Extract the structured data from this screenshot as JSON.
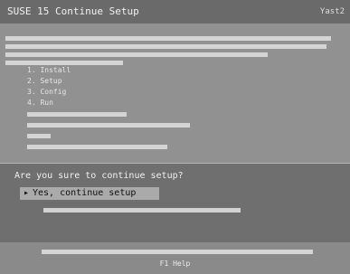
{
  "header": {
    "title": "SUSE 15 Continue Setup",
    "brand": "Yast2"
  },
  "info": {
    "items": [
      {
        "text": "1. Install"
      },
      {
        "text": "2. Setup"
      },
      {
        "text": "3. Config"
      },
      {
        "text": "4. Run"
      },
      {
        "text": ""
      },
      {
        "text": ""
      },
      {
        "text": ""
      },
      {
        "text": ""
      }
    ]
  },
  "prompt": {
    "question": "Are you sure to continue setup?",
    "options": [
      {
        "label": "Yes, continue setup",
        "selected": true
      },
      {
        "label": "",
        "selected": false
      }
    ]
  },
  "footer": {
    "line1": "",
    "line2": "F1 Help"
  }
}
